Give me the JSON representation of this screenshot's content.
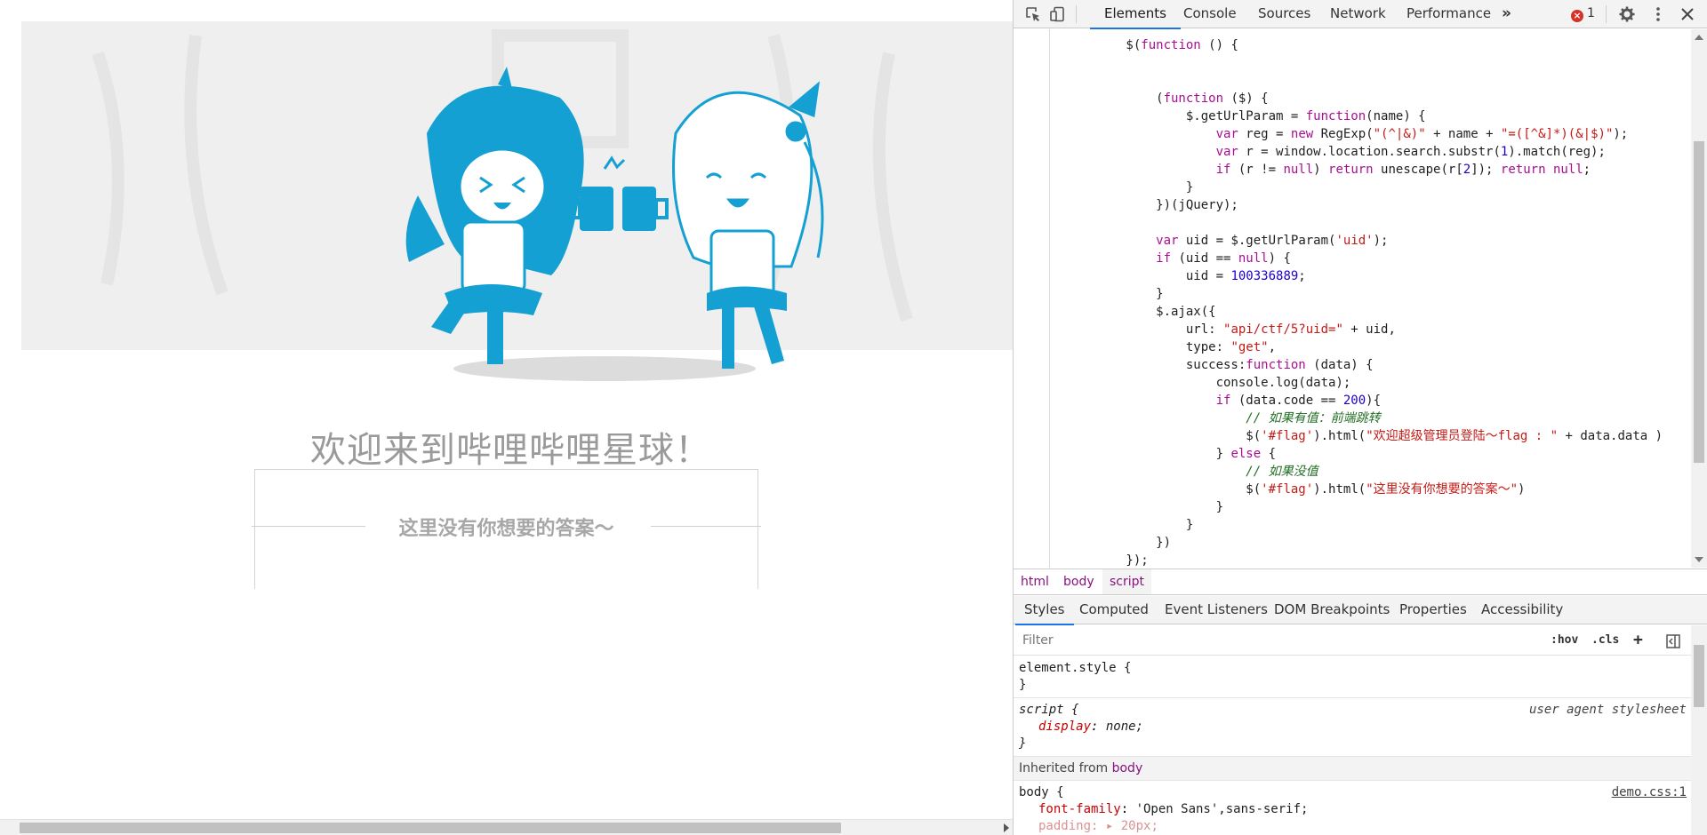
{
  "page": {
    "welcome": "欢迎来到哔哩哔哩星球！",
    "flag_text": "这里没有你想要的答案～"
  },
  "devtools": {
    "tabs": [
      "Elements",
      "Console",
      "Sources",
      "Network",
      "Performance"
    ],
    "more_tabs": "»",
    "error_count": "1",
    "code_lines": [
      "        $(function () {",
      "",
      "",
      "            (function ($) {",
      "                $.getUrlParam = function(name) {",
      "                    var reg = new RegExp(\"(^|&)\" + name + \"=([^&]*)(&|$)\");",
      "                    var r = window.location.search.substr(1).match(reg);",
      "                    if (r != null) return unescape(r[2]); return null;",
      "                }",
      "            })(jQuery);",
      "",
      "            var uid = $.getUrlParam('uid');",
      "            if (uid == null) {",
      "                uid = 100336889;",
      "            }",
      "            $.ajax({",
      "                url: \"api/ctf/5?uid=\" + uid,",
      "                type: \"get\",",
      "                success:function (data) {",
      "                    console.log(data);",
      "                    if (data.code == 200){",
      "                        // 如果有值：前端跳转",
      "                        $('#flag').html(\"欢迎超级管理员登陆～flag : \" + data.data )",
      "                    } else {",
      "                        // 如果没值",
      "                        $('#flag').html(\"这里没有你想要的答案～\")",
      "                    }",
      "                }",
      "            })",
      "        });"
    ],
    "breadcrumbs": [
      "html",
      "body",
      "script"
    ],
    "subtabs": [
      "Styles",
      "Computed",
      "Event Listeners",
      "DOM Breakpoints",
      "Properties",
      "Accessibility"
    ],
    "filter_placeholder": "Filter",
    "hov": ":hov",
    "cls": ".cls",
    "plus": "+",
    "rules": {
      "element_style": "element.style {",
      "close": "}",
      "script_sel": "script {",
      "script_src": "user agent stylesheet",
      "display_prop": "display",
      "display_val": "none;",
      "inherited_label": "Inherited from",
      "inherited_tag": "body",
      "body_sel": "body {",
      "body_src": "demo.css:1",
      "ff_prop": "font-family",
      "ff_val": "'Open Sans',sans-serif;",
      "pad_prop": "padding",
      "pad_val": "20px;"
    }
  },
  "colors": {
    "accent": "#1a73e8",
    "mascot": "#14a0d2"
  }
}
